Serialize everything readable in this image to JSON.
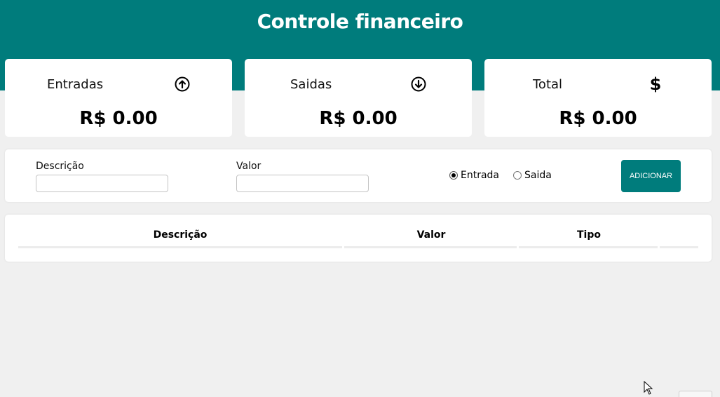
{
  "header": {
    "title": "Controle financeiro",
    "background": "#007c7c"
  },
  "cards": [
    {
      "label": "Entradas",
      "icon": "arrow-up-circle-icon",
      "value": "R$ 0.00"
    },
    {
      "label": "Saidas",
      "icon": "arrow-down-circle-icon",
      "value": "R$ 0.00"
    },
    {
      "label": "Total",
      "icon": "dollar-icon",
      "icon_text": "$",
      "value": "R$ 0.00"
    }
  ],
  "form": {
    "description_label": "Descrição",
    "description_value": "",
    "amount_label": "Valor",
    "amount_value": "",
    "type_options": [
      {
        "label": "Entrada",
        "checked": true
      },
      {
        "label": "Saida",
        "checked": false
      }
    ],
    "add_button": "ADICIONAR"
  },
  "table": {
    "columns": [
      "Descrição",
      "Valor",
      "Tipo"
    ],
    "rows": []
  },
  "colors": {
    "accent": "#007c7c",
    "page_bg": "#f0f0f0"
  }
}
